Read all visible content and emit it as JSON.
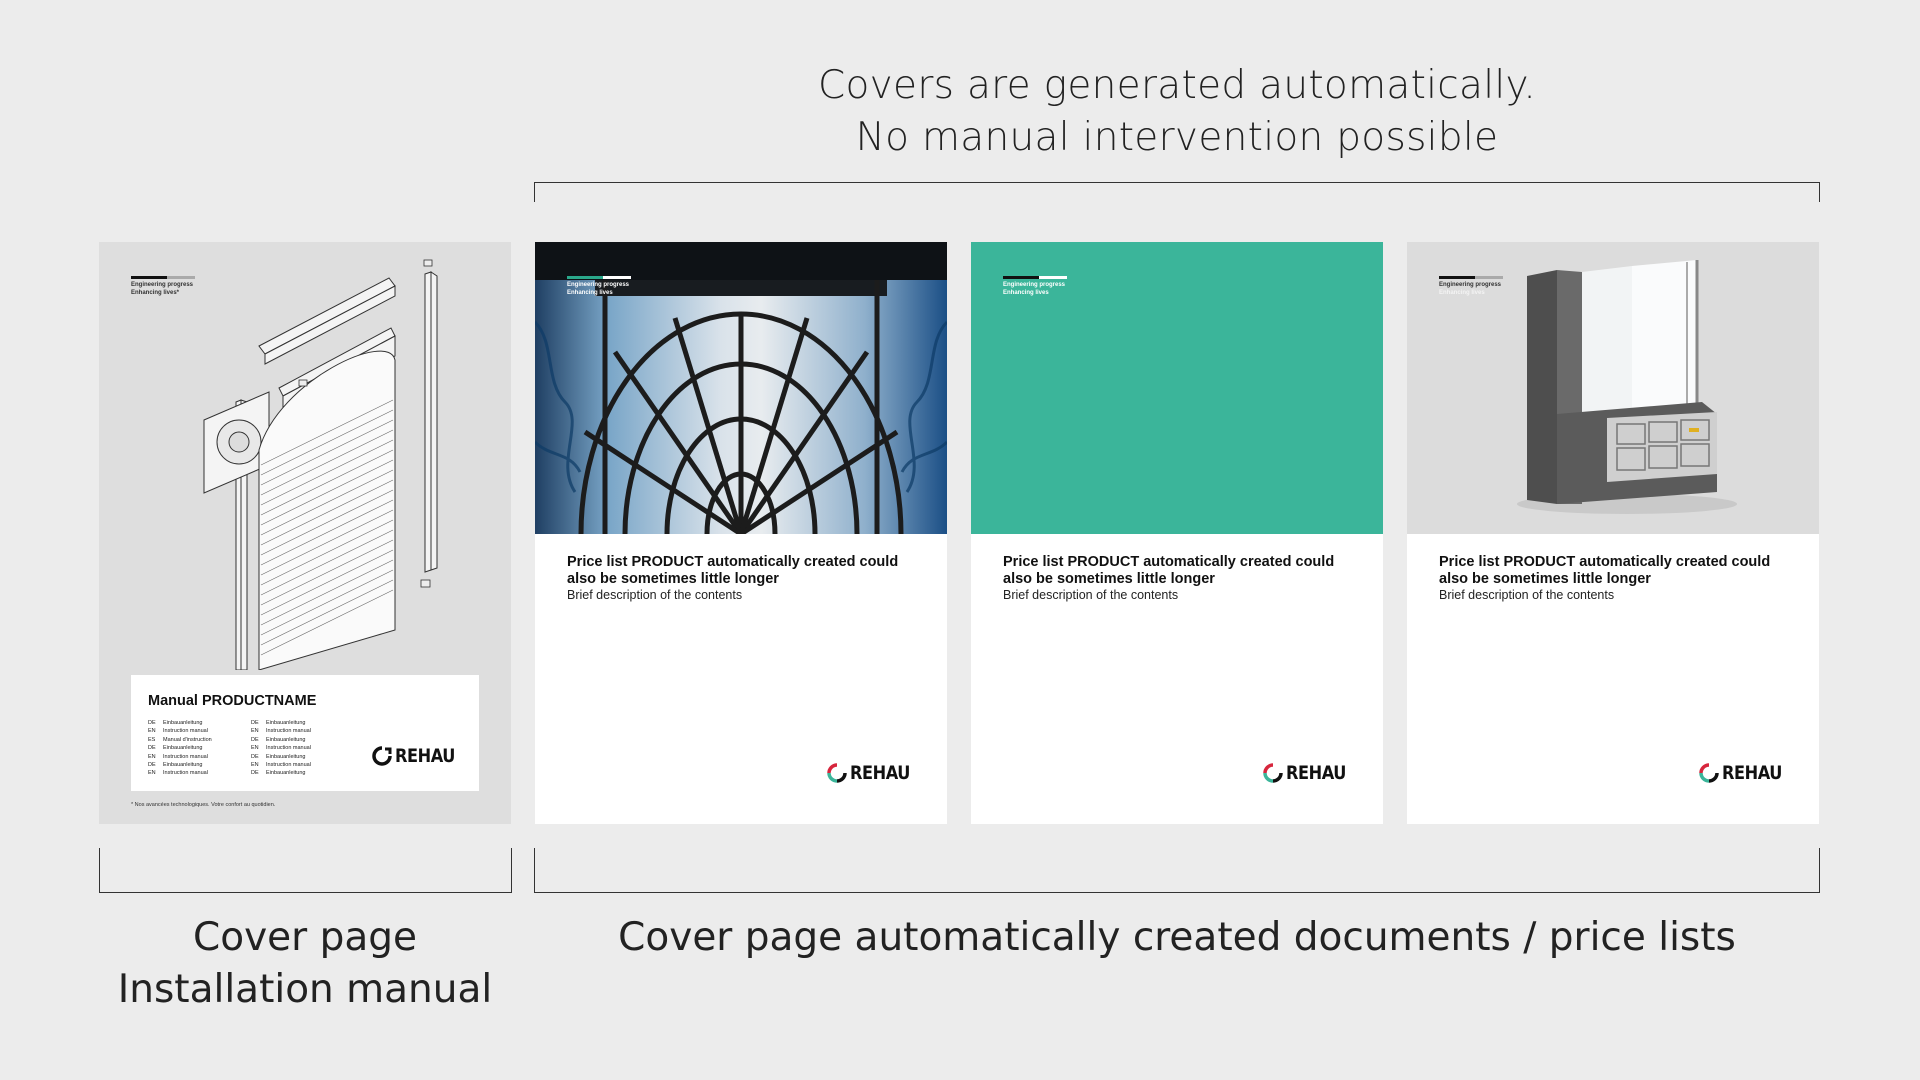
{
  "header": {
    "line1": "Covers are generated automatically.",
    "line2": "No manual intervention possible"
  },
  "captions": {
    "left_line1": "Cover page",
    "left_line2": "Installation manual",
    "right": "Cover page automatically created documents / price lists"
  },
  "brand": {
    "tagline1": "Engineering progress",
    "tagline2": "Enhancing lives",
    "tagline2_star": "Enhancing lives*",
    "logo_text": "REHAU",
    "accent": "#3bb59a",
    "logo_red": "#d7263d"
  },
  "manual": {
    "title": "Manual PRODUCTNAME",
    "col1": [
      {
        "code": "DE",
        "text": "Einbauanleitung"
      },
      {
        "code": "EN",
        "text": "Instruction manual"
      },
      {
        "code": "ES",
        "text": "Manual d'instruction"
      },
      {
        "code": "DE",
        "text": "Einbauanleitung"
      },
      {
        "code": "EN",
        "text": "Instruction manual"
      },
      {
        "code": "DE",
        "text": "Einbauanleitung"
      },
      {
        "code": "EN",
        "text": "Instruction manual"
      }
    ],
    "col2": [
      {
        "code": "DE",
        "text": "Einbauanleitung"
      },
      {
        "code": "EN",
        "text": "Instruction manual"
      },
      {
        "code": "DE",
        "text": "Einbauanleitung"
      },
      {
        "code": "EN",
        "text": "Instruction manual"
      },
      {
        "code": "DE",
        "text": "Einbauanleitung"
      },
      {
        "code": "EN",
        "text": "Instruction manual"
      },
      {
        "code": "DE",
        "text": "Einbauanleitung"
      }
    ],
    "footnote": "* Nos avancées technologiques. Votre confort au quotidien."
  },
  "pricelists": [
    {
      "title": "Price list PRODUCT automatically created could also be sometimes little longer",
      "description": "Brief description of the contents"
    },
    {
      "title": "Price list PRODUCT automatically created could also be sometimes little longer",
      "description": "Brief description of the contents"
    },
    {
      "title": "Price list PRODUCT automatically created could also be sometimes little longer",
      "description": "Brief description of the contents"
    }
  ]
}
